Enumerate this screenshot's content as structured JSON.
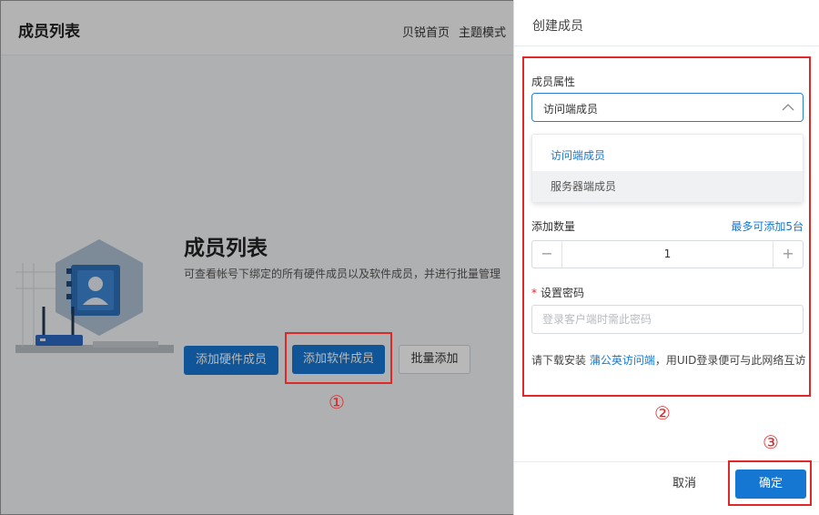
{
  "header": {
    "title": "成员列表",
    "nav": [
      "贝锐首页",
      "主题模式"
    ]
  },
  "hero": {
    "title": "成员列表",
    "description": "可查看帐号下绑定的所有硬件成员以及软件成员，并进行批量管理",
    "buttons": {
      "add_hardware": "添加硬件成员",
      "add_software": "添加软件成员",
      "batch_add": "批量添加"
    }
  },
  "drawer": {
    "title": "创建成员",
    "member_attr": {
      "label": "成员属性",
      "selected": "访问端成员",
      "options": [
        "访问端成员",
        "服务器端成员"
      ]
    },
    "quantity": {
      "label": "添加数量",
      "limit_text": "最多可添加5台",
      "value": "1",
      "minus": "−",
      "plus": "+"
    },
    "password": {
      "label": "设置密码",
      "required_mark": "*",
      "placeholder": "登录客户端时需此密码",
      "value": ""
    },
    "hint": {
      "prefix": "请下载安装 ",
      "link": "蒲公英访问端",
      "suffix": "，用UID登录便可与此网络互访"
    },
    "footer": {
      "cancel": "取消",
      "confirm": "确定"
    }
  },
  "annotations": {
    "step1": "①",
    "step2": "②",
    "step3": "③"
  },
  "colors": {
    "primary": "#1677d2",
    "annotation_red": "#e12828",
    "overlay": "rgba(0,0,0,0.28)"
  }
}
